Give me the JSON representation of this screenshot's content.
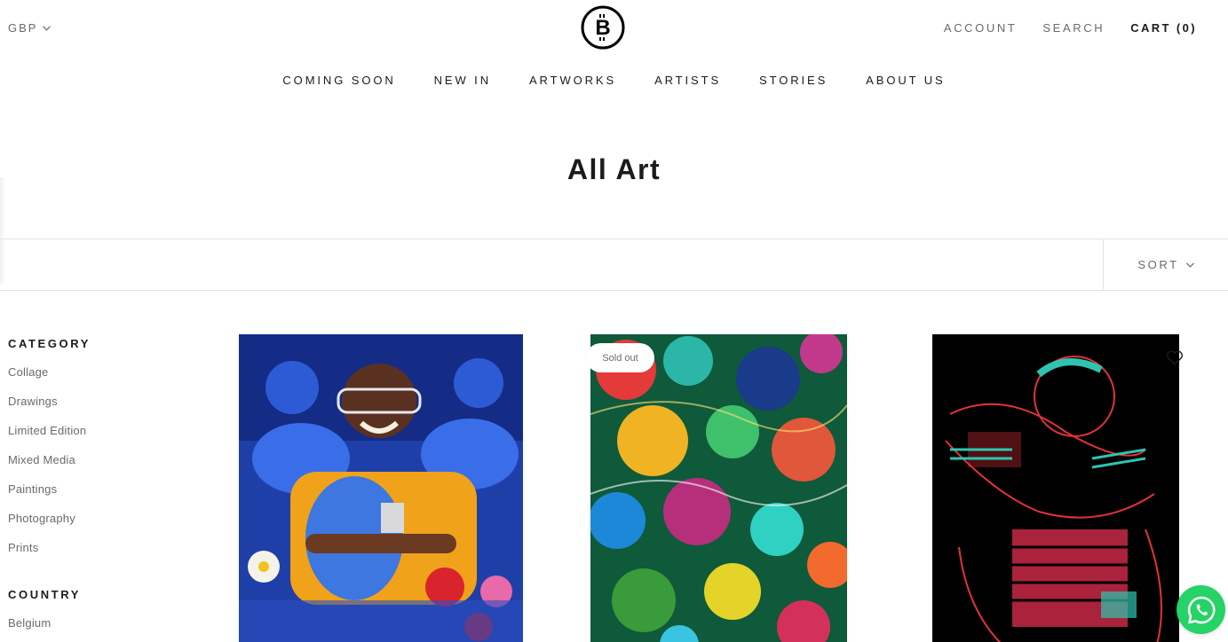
{
  "header": {
    "currency": "GBP",
    "logo_letter": "B",
    "account": "ACCOUNT",
    "search": "SEARCH",
    "cart": "CART (0)"
  },
  "nav": {
    "items": [
      "COMING SOON",
      "NEW IN",
      "ARTWORKS",
      "ARTISTS",
      "STORIES",
      "ABOUT US"
    ]
  },
  "page": {
    "title": "All Art"
  },
  "toolbar": {
    "sort_label": "SORT"
  },
  "filters": {
    "category_heading": "CATEGORY",
    "categories": [
      "Collage",
      "Drawings",
      "Limited Edition",
      "Mixed Media",
      "Paintings",
      "Photography",
      "Prints"
    ],
    "country_heading": "COUNTRY",
    "countries": [
      "Belgium"
    ]
  },
  "products": [
    {
      "badge": ""
    },
    {
      "badge": "Sold out"
    },
    {
      "badge": ""
    }
  ],
  "colors": {
    "text": "#1c1b1b",
    "muted": "#6a6a6a",
    "border": "#e4e4e4",
    "whatsapp": "#25d366"
  }
}
